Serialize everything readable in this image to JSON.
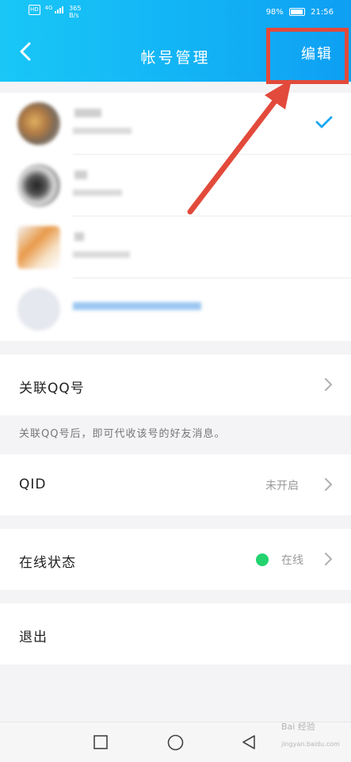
{
  "status_bar": {
    "network_badge": "HD",
    "network_type": "4G",
    "speed_value": "365",
    "speed_unit": "B/s",
    "battery": "98%",
    "time": "21:56"
  },
  "header": {
    "title": "帐号管理",
    "edit_label": "编辑"
  },
  "settings": {
    "link_qq": {
      "label": "关联QQ号"
    },
    "link_hint": "关联QQ号后，即可代收该号的好友消息。",
    "qid": {
      "label": "QID",
      "value": "未开启"
    },
    "online_status": {
      "label": "在线状态",
      "value": "在线",
      "dot_color": "#22d36e"
    },
    "logout": {
      "label": "退出"
    }
  },
  "colors": {
    "header_gradient_start": "#19c7f7",
    "header_gradient_end": "#0e9ff3",
    "annotation_red": "#e24a3b",
    "check_blue": "#1aa7f2"
  },
  "watermark": {
    "text": "Bai 经验",
    "url": "jingyan.baidu.com"
  }
}
